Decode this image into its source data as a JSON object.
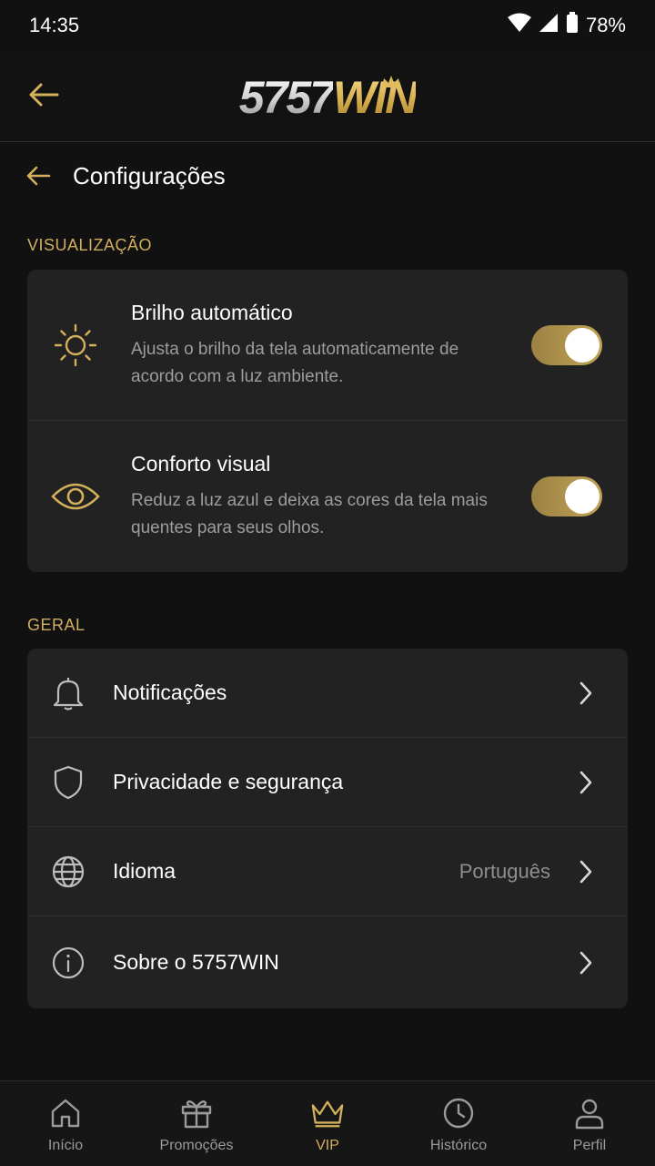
{
  "status_bar": {
    "time": "14:35",
    "battery": "78%"
  },
  "header": {
    "logo_number": "5757",
    "logo_word": "WIN"
  },
  "page": {
    "title": "Configurações"
  },
  "sections": {
    "display": {
      "label": "VISUALIZAÇÃO",
      "items": [
        {
          "title": "Brilho automático",
          "description": "Ajusta o brilho da tela automaticamente de acordo com a luz ambiente.",
          "enabled": true,
          "icon": "sun-icon"
        },
        {
          "title": "Conforto visual",
          "description": "Reduz a luz azul e deixa as cores da tela mais quentes para seus olhos.",
          "enabled": true,
          "icon": "eye-icon"
        }
      ]
    },
    "general": {
      "label": "GERAL",
      "items": [
        {
          "label": "Notificações",
          "icon": "bell-icon"
        },
        {
          "label": "Privacidade e segurança",
          "icon": "shield-icon"
        },
        {
          "label": "Idioma",
          "value": "Português",
          "icon": "globe-icon"
        },
        {
          "label": "Sobre o 5757WIN",
          "icon": "info-icon"
        }
      ]
    }
  },
  "bottom_nav": [
    {
      "label": "Início",
      "icon": "home-icon"
    },
    {
      "label": "Promoções",
      "icon": "gift-icon"
    },
    {
      "label": "VIP",
      "icon": "crown-icon",
      "active": true
    },
    {
      "label": "Histórico",
      "icon": "clock-icon"
    },
    {
      "label": "Perfil",
      "icon": "user-icon"
    }
  ],
  "colors": {
    "accent": "#d4b05a",
    "background": "#111111",
    "card": "#222222"
  }
}
